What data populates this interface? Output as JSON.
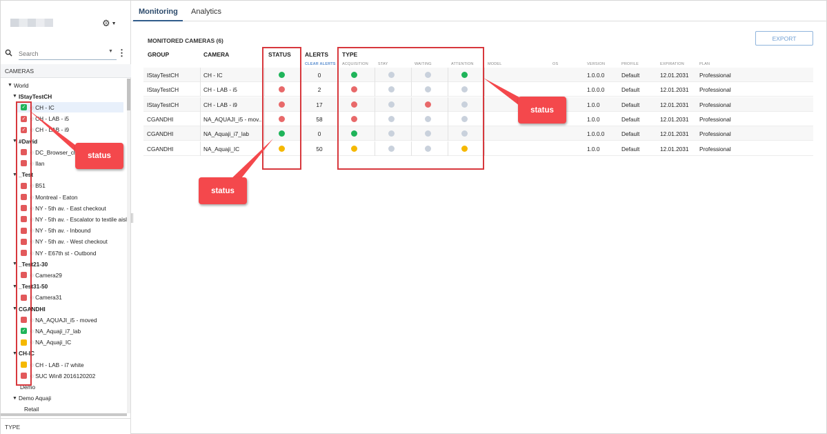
{
  "sidebar": {
    "search_placeholder": "Search",
    "cameras_header": "CAMERAS",
    "type_footer": "TYPE",
    "tree": [
      {
        "label": "World",
        "kind": "root"
      },
      {
        "label": "IStayTestCH",
        "kind": "group"
      },
      {
        "label": "CH - IC",
        "kind": "cam",
        "status": "#1fb45a",
        "selected": true
      },
      {
        "label": "CH - LAB - i5",
        "kind": "cam",
        "status": "#e2595b"
      },
      {
        "label": "CH - LAB - i9",
        "kind": "cam",
        "status": "#e2595b"
      },
      {
        "label": "#David",
        "kind": "group"
      },
      {
        "label": "DC_Browser_ch",
        "kind": "cam",
        "status": "#e2595b"
      },
      {
        "label": "Ilan",
        "kind": "cam",
        "status": "#e2595b"
      },
      {
        "label": "_Test",
        "kind": "group"
      },
      {
        "label": "B51",
        "kind": "cam",
        "status": "#e2595b"
      },
      {
        "label": "Montreal - Eaton",
        "kind": "cam",
        "status": "#e2595b"
      },
      {
        "label": "NY - 5th av. - East checkout",
        "kind": "cam",
        "status": "#e2595b"
      },
      {
        "label": "NY - 5th av. - Escalator to textile aisl",
        "kind": "cam",
        "status": "#e2595b"
      },
      {
        "label": "NY - 5th av. - Inbound",
        "kind": "cam",
        "status": "#e2595b"
      },
      {
        "label": "NY - 5th av. - West checkout",
        "kind": "cam",
        "status": "#e2595b"
      },
      {
        "label": "NY - E67th st - Outbond",
        "kind": "cam",
        "status": "#e2595b"
      },
      {
        "label": "_Test21-30",
        "kind": "group"
      },
      {
        "label": "Camera29",
        "kind": "cam",
        "status": "#e2595b"
      },
      {
        "label": "_Test31-50",
        "kind": "group"
      },
      {
        "label": "Camera31",
        "kind": "cam",
        "status": "#e2595b"
      },
      {
        "label": "CGANDHI",
        "kind": "group"
      },
      {
        "label": "NA_AQUAJI_i5 - moved",
        "kind": "cam",
        "status": "#e2595b"
      },
      {
        "label": "NA_Aquaji_i7_lab",
        "kind": "cam",
        "status": "#1fb45a"
      },
      {
        "label": "NA_Aquaji_IC",
        "kind": "cam",
        "status": "#f5b800"
      },
      {
        "label": "CH-IC",
        "kind": "group"
      },
      {
        "label": "CH - LAB - i7 white",
        "kind": "cam",
        "status": "#f5b800"
      },
      {
        "label": "SUC Win8 2016120202",
        "kind": "cam",
        "status": "#e2595b"
      },
      {
        "label": "Demo",
        "kind": "leaf"
      },
      {
        "label": "Demo Aquaji",
        "kind": "subroot"
      },
      {
        "label": "Retail",
        "kind": "leaf2"
      }
    ]
  },
  "tabs": [
    {
      "label": "Monitoring",
      "active": true
    },
    {
      "label": "Analytics",
      "active": false
    }
  ],
  "main": {
    "title": "MONITORED CAMERAS (6)",
    "export_label": "EXPORT",
    "columns": {
      "group": "GROUP",
      "camera": "CAMERA",
      "status": "STATUS",
      "alerts": "ALERTS",
      "type": "TYPE",
      "clear_alerts": "CLEAR ALERTS",
      "acquisition": "ACQUISITION",
      "stay": "STAY",
      "waiting": "WAITING",
      "attention": "ATTENTION",
      "model": "MODEL",
      "os": "OS",
      "version": "VERSION",
      "profile": "PROFILE",
      "expiration": "EXPIRATION",
      "plan": "PLAN"
    },
    "rows": [
      {
        "group": "IStayTestCH",
        "camera": "CH - IC",
        "status": "green",
        "alerts": "0",
        "acq": "green",
        "stay": "grey",
        "waiting": "grey",
        "attention": "green",
        "version": "1.0.0.0",
        "profile": "Default",
        "expiration": "12.01.2031",
        "plan": "Professional"
      },
      {
        "group": "IStayTestCH",
        "camera": "CH - LAB - i5",
        "status": "red",
        "alerts": "2",
        "acq": "red",
        "stay": "grey",
        "waiting": "grey",
        "attention": "grey",
        "version": "1.0.0.0",
        "profile": "Default",
        "expiration": "12.01.2031",
        "plan": "Professional"
      },
      {
        "group": "IStayTestCH",
        "camera": "CH - LAB - i9",
        "status": "red",
        "alerts": "17",
        "acq": "red",
        "stay": "grey",
        "waiting": "red",
        "attention": "grey",
        "version": "1.0.0",
        "profile": "Default",
        "expiration": "12.01.2031",
        "plan": "Professional"
      },
      {
        "group": "CGANDHI",
        "camera": "NA_AQUAJI_i5 - mov...",
        "status": "red",
        "alerts": "58",
        "acq": "red",
        "stay": "grey",
        "waiting": "grey",
        "attention": "grey",
        "version": "1.0.0",
        "profile": "Default",
        "expiration": "12.01.2031",
        "plan": "Professional"
      },
      {
        "group": "CGANDHI",
        "camera": "NA_Aquaji_i7_lab",
        "status": "green",
        "alerts": "0",
        "acq": "green",
        "stay": "grey",
        "waiting": "grey",
        "attention": "grey",
        "version": "1.0.0.0",
        "profile": "Default",
        "expiration": "12.01.2031",
        "plan": "Professional"
      },
      {
        "group": "CGANDHI",
        "camera": "NA_Aquaji_IC",
        "status": "yellow",
        "alerts": "50",
        "acq": "yellow",
        "stay": "grey",
        "waiting": "grey",
        "attention": "yellow",
        "version": "1.0.0",
        "profile": "Default",
        "expiration": "12.01.2031",
        "plan": "Professional"
      }
    ]
  },
  "colors": {
    "green": "#1fb45a",
    "red": "#e8696a",
    "yellow": "#f5b800",
    "grey": "#c9d1dc",
    "annotation": "#f4484c"
  },
  "annotations": {
    "callout_label": "status"
  },
  "icons": [
    "gear-icon",
    "search-icon",
    "more-vert-icon",
    "caret-down-icon",
    "camera-icon",
    "check-icon"
  ]
}
